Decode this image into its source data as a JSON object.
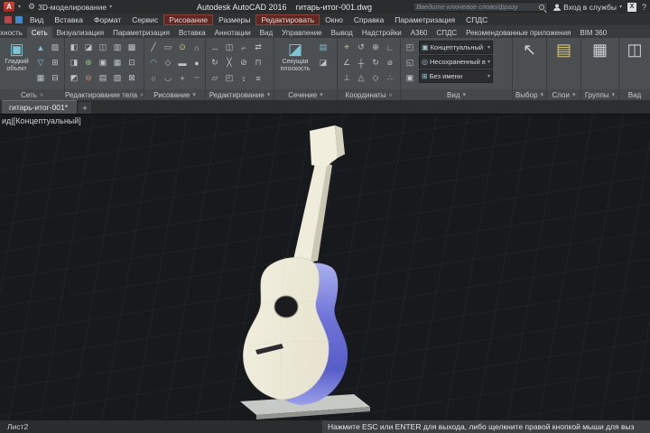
{
  "title_bar": {
    "logo_letter": "A",
    "workspace_label": "3D-моделирование",
    "app_name": "Autodesk AutoCAD 2016",
    "doc_name": "гитарь-итог-001.dwg",
    "search_placeholder": "Введите ключевое слово/фразу",
    "sign_in_label": "Вход в службы",
    "exchange_label": "X",
    "help_label": "?"
  },
  "menu_bar": {
    "items": [
      {
        "label": "Вид"
      },
      {
        "label": "Вставка"
      },
      {
        "label": "Формат"
      },
      {
        "label": "Сервис"
      },
      {
        "label": "Рисование"
      },
      {
        "label": "Размеры"
      },
      {
        "label": "Редактировать"
      },
      {
        "label": "Окно"
      },
      {
        "label": "Справка"
      },
      {
        "label": "Параметризация"
      },
      {
        "label": "СПДС"
      }
    ]
  },
  "ribbon_tabs": {
    "items": [
      "Поверхность",
      "Сеть",
      "Визуализация",
      "Параметризация",
      "Вставка",
      "Аннотации",
      "Вид",
      "Управление",
      "Вывод",
      "Надстройки",
      "A360",
      "СПДС",
      "Рекомендованные приложения",
      "BIM 360"
    ]
  },
  "ribbon": {
    "smooth_object_label": "Гладкий объект",
    "section_plane_label": "Секущая плоскость",
    "visual_style_value": "Концептуальный",
    "named_view_value": "Несохраненный вид",
    "ucs_value": "Без имени",
    "panels": [
      {
        "label": "Сеть",
        "chev": "»"
      },
      {
        "label": "Редактирование тела",
        "chev": "»"
      },
      {
        "label": "Рисование",
        "chev": "▾"
      },
      {
        "label": "Редактирование",
        "chev": "▾"
      },
      {
        "label": "Сечение",
        "chev": "▾"
      },
      {
        "label": "Координаты",
        "chev": "»"
      },
      {
        "label": "Вид",
        "chev": "▾"
      }
    ],
    "right_panels": [
      {
        "label": "Выбор"
      },
      {
        "label": "Слои"
      },
      {
        "label": "Группы"
      },
      {
        "label": "Вид"
      }
    ],
    "icons": {
      "net": [
        {
          "g": "▲",
          "c": "#7fc4d4"
        },
        {
          "g": "▽",
          "c": "#7fc4d4"
        },
        "▦",
        "▨",
        "⊞",
        "⊟"
      ],
      "solid_edit": [
        "◧",
        "◨",
        "◩",
        "◪",
        {
          "g": "⊕",
          "c": "#8fc47f"
        },
        {
          "g": "⊖",
          "c": "#d48f7f"
        },
        "◫",
        "▣",
        "▤",
        "▥",
        "▦",
        "▧",
        "▩",
        "⊡",
        "⊠"
      ],
      "draw": [
        "╱",
        {
          "g": "◠",
          "c": "#7fc4d4"
        },
        "○",
        "▭",
        "◇",
        "◡",
        {
          "g": "⊙",
          "c": "#d4c47f"
        },
        "▬",
        "+",
        "∩",
        "●",
        "┈"
      ],
      "edit": [
        "↔",
        "↻",
        "▱",
        "◫",
        "╳",
        "◰",
        "⌐",
        "⊘",
        "↕",
        "⇄",
        "⊓",
        "≡"
      ],
      "section": [
        {
          "g": "▤",
          "c": "#7fc4d4"
        },
        "◪"
      ],
      "coords": [
        {
          "g": "⌖",
          "c": "#d4c47f"
        },
        "∠",
        "⊥",
        "↺",
        "┼",
        "△",
        "⊕",
        "↻",
        "◇",
        "∟",
        "⌀",
        "∴"
      ],
      "view": [
        "◰",
        "◱",
        "▣"
      ]
    }
  },
  "file_tabs": {
    "active_tab": "гитарь-итог-001*",
    "new_tab_label": "+"
  },
  "viewport": {
    "overlay_label": "ид|[Концептуальный]"
  },
  "status_bar": {
    "layout_tab": "Лист2",
    "message": "Нажмите ESC или ENTER для выхода, либо щелкните правой кнопкой мыши для выз"
  }
}
